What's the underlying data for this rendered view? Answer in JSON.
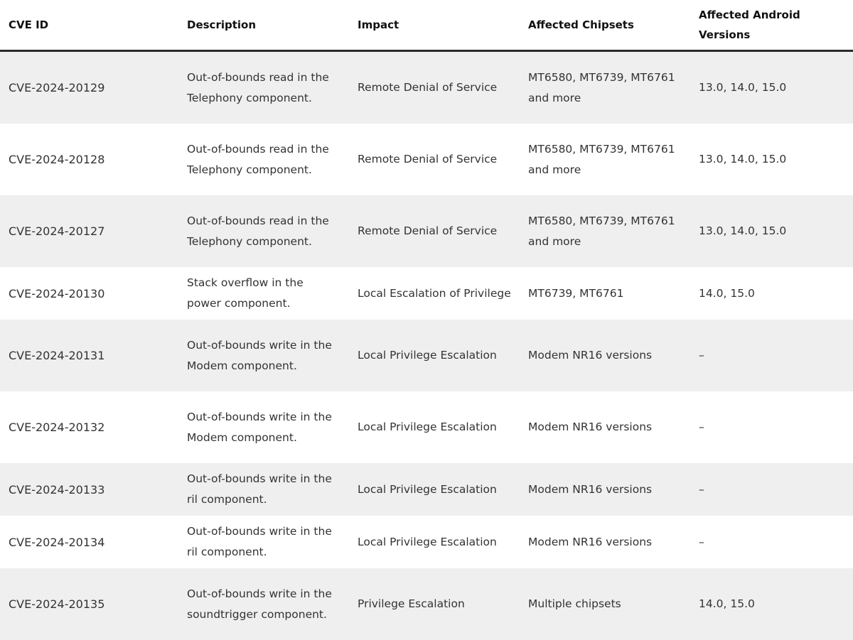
{
  "table": {
    "headers": [
      "CVE ID",
      "Description",
      "Impact",
      "Affected Chipsets",
      "Affected Android Versions"
    ],
    "rows": [
      {
        "id": "CVE-2024-20129",
        "description": "Out-of-bounds read in the Telephony component.",
        "impact": "Remote Denial of Service",
        "chipsets": "MT6580, MT6739, MT6761 and more",
        "versions": "13.0, 14.0, 15.0"
      },
      {
        "id": "CVE-2024-20128",
        "description": "Out-of-bounds read in the Telephony component.",
        "impact": "Remote Denial of Service",
        "chipsets": "MT6580, MT6739, MT6761 and more",
        "versions": "13.0, 14.0, 15.0"
      },
      {
        "id": "CVE-2024-20127",
        "description": "Out-of-bounds read in the Telephony component.",
        "impact": "Remote Denial of Service",
        "chipsets": "MT6580, MT6739, MT6761 and more",
        "versions": "13.0, 14.0, 15.0"
      },
      {
        "id": "CVE-2024-20130",
        "description": "Stack overflow in the power component.",
        "impact": "Local Escalation of Privilege",
        "chipsets": "MT6739, MT6761",
        "versions": "14.0, 15.0"
      },
      {
        "id": "CVE-2024-20131",
        "description": "Out-of-bounds write in the Modem component.",
        "impact": "Local Privilege Escalation",
        "chipsets": "Modem NR16 versions",
        "versions": "–"
      },
      {
        "id": "CVE-2024-20132",
        "description": "Out-of-bounds write in the Modem component.",
        "impact": "Local Privilege Escalation",
        "chipsets": "Modem NR16 versions",
        "versions": "–"
      },
      {
        "id": "CVE-2024-20133",
        "description": "Out-of-bounds write in the ril component.",
        "impact": "Local Privilege Escalation",
        "chipsets": "Modem NR16 versions",
        "versions": "–"
      },
      {
        "id": "CVE-2024-20134",
        "description": "Out-of-bounds write in the ril component.",
        "impact": "Local Privilege Escalation",
        "chipsets": "Modem NR16 versions",
        "versions": "–"
      },
      {
        "id": "CVE-2024-20135",
        "description": "Out-of-bounds write in the soundtrigger component.",
        "impact": "Privilege Escalation",
        "chipsets": "Multiple chipsets",
        "versions": "14.0, 15.0"
      }
    ]
  }
}
